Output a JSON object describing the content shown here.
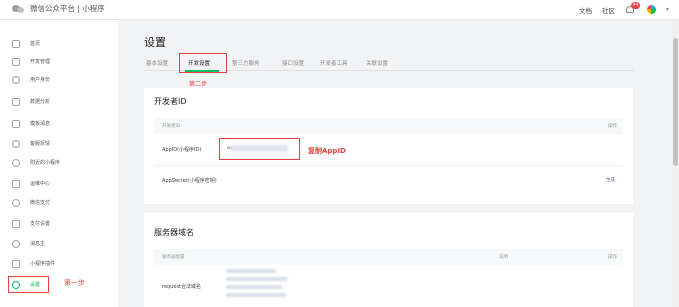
{
  "header": {
    "brand": "微信公众平台 | 小程序",
    "links": [
      "文档",
      "社区"
    ],
    "notification_count": "99"
  },
  "sidebar": {
    "items": [
      {
        "label": "首页",
        "icon": "home-icon"
      },
      {
        "label": "开发管理",
        "icon": "code-icon"
      },
      {
        "label": "用户身份",
        "icon": "user-icon"
      },
      {
        "label": "数据分析",
        "icon": "chart-icon"
      },
      {
        "label": "模板消息",
        "icon": "document-icon"
      },
      {
        "label": "客服反馈",
        "icon": "feedback-icon"
      },
      {
        "label": "附近的小程序",
        "icon": "location-icon"
      },
      {
        "label": "运维中心",
        "icon": "wrench-icon"
      },
      {
        "label": "微信支付",
        "icon": "pay-icon"
      },
      {
        "label": "支付设置",
        "icon": "clipboard-icon"
      },
      {
        "label": "消息主",
        "icon": "people-icon"
      },
      {
        "label": "小程序插件",
        "icon": "grid-icon"
      },
      {
        "label": "设置",
        "icon": "gear-icon"
      }
    ],
    "active_item": "设置",
    "step_annotation": "第一步"
  },
  "main": {
    "title": "设置",
    "tabs": [
      "基本设置",
      "开发设置",
      "第三方服务",
      "接口设置",
      "开发者工具",
      "关联设置"
    ],
    "active_tab": "开发设置",
    "step_annotation": "第二步"
  },
  "developer_card": {
    "title": "开发者ID",
    "header_left": "开发者ID",
    "header_right": "操作",
    "appid_label": "AppID(小程序ID)",
    "appid_value": "wx",
    "copy_annotation": "复制AppID",
    "secret_label": "AppSecret(小程序密钥)",
    "secret_action": "生成"
  },
  "server_card": {
    "title": "服务器域名",
    "header_left": "服务器配置",
    "header_mid": "说明",
    "header_right": "操作",
    "request_label": "request合法域名"
  },
  "colors": {
    "accent": "#07c160",
    "annotation": "#e64340",
    "link": "#576b95"
  }
}
